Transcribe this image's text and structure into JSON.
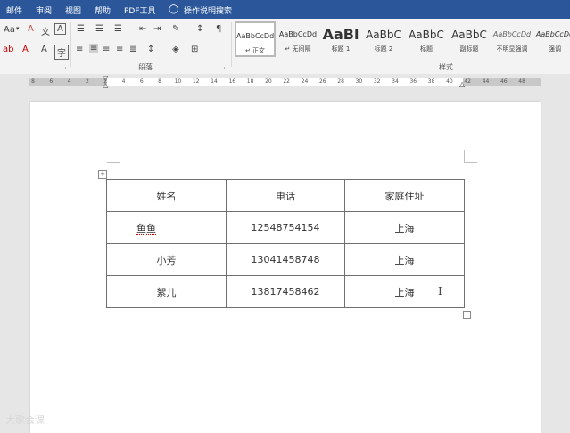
{
  "menubar": {
    "tabs": [
      "邮件",
      "审阅",
      "视图",
      "帮助",
      "PDF工具"
    ],
    "search_label": "操作说明搜索"
  },
  "ribbon": {
    "font_size_label": "Aa",
    "paragraph_group_label": "段落",
    "styles_group_label": "样式",
    "styles": [
      {
        "preview": "AaBbCcDd",
        "name": "↵ 正文",
        "selected": true
      },
      {
        "preview": "AaBbCcDd",
        "name": "↵ 无间隔"
      },
      {
        "preview": "AaBl",
        "name": "标题 1"
      },
      {
        "preview": "AaBbC",
        "name": "标题 2"
      },
      {
        "preview": "AaBbC",
        "name": "标题"
      },
      {
        "preview": "AaBbC",
        "name": "副标题"
      },
      {
        "preview": "AaBbCcDd",
        "name": "不明显强调"
      },
      {
        "preview": "AaBbCcDd",
        "name": "强调"
      }
    ]
  },
  "ruler": {
    "marks": [
      "8",
      "6",
      "4",
      "2",
      "2",
      "4",
      "6",
      "8",
      "10",
      "12",
      "14",
      "16",
      "18",
      "20",
      "22",
      "24",
      "26",
      "28",
      "30",
      "32",
      "34",
      "36",
      "38",
      "40",
      "42",
      "44",
      "46",
      "48"
    ]
  },
  "table": {
    "rows": [
      [
        "姓名",
        "电话",
        "家庭住址"
      ],
      [
        "鱼鱼",
        "12548754154",
        "上海"
      ],
      [
        "小芳",
        "13041458748",
        "上海"
      ],
      [
        "絮儿",
        "13817458462",
        "上海"
      ]
    ]
  },
  "watermark": "大歌会课"
}
